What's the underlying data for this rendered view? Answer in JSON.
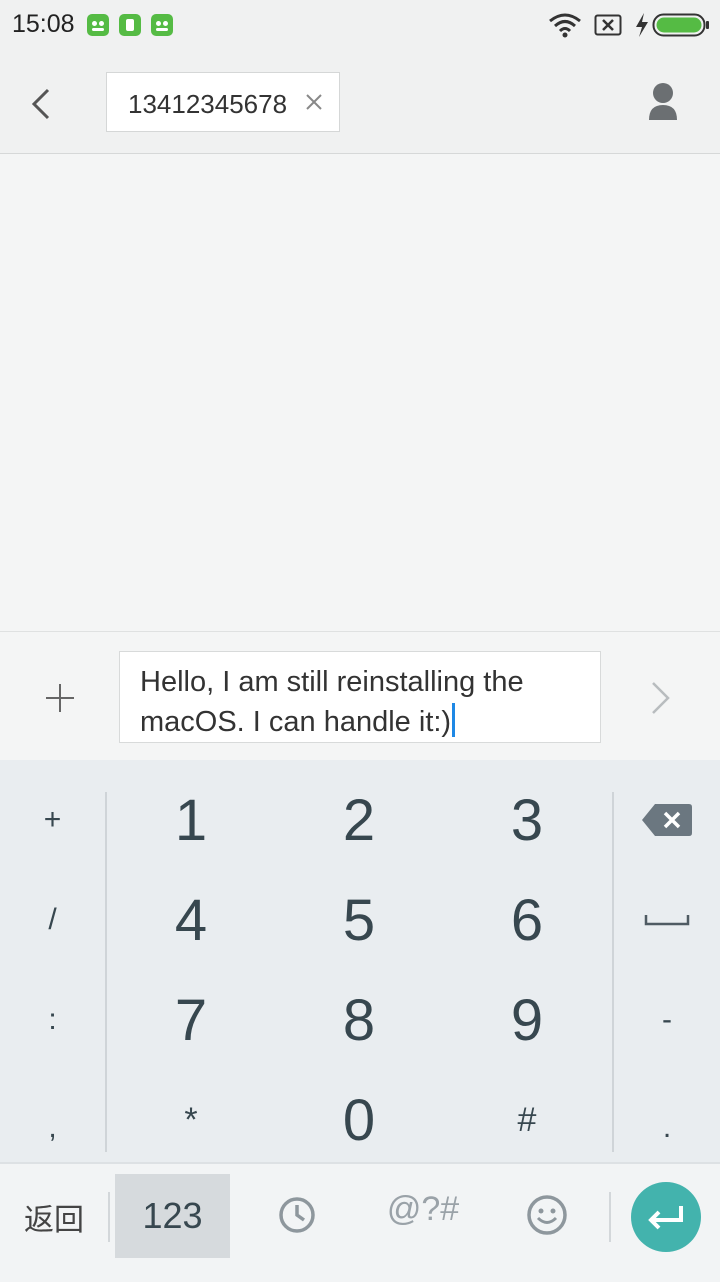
{
  "status_bar": {
    "time": "15:08",
    "icons": [
      "app-notification-icon",
      "sim-card-icon",
      "app-notification-icon",
      "wifi-icon",
      "no-sim-icon",
      "charging-icon",
      "battery-icon"
    ]
  },
  "header": {
    "recipient": "13412345678",
    "icons": [
      "back-arrow-icon",
      "clear-icon",
      "contact-icon"
    ]
  },
  "composer": {
    "message_text": "Hello, I am still reinstalling the macOS. I can handle it:)",
    "icons": [
      "plus-icon",
      "send-arrow-icon"
    ]
  },
  "keypad": {
    "left_column": [
      "+",
      "/",
      ":",
      ","
    ],
    "digits": [
      [
        "1",
        "2",
        "3"
      ],
      [
        "4",
        "5",
        "6"
      ],
      [
        "7",
        "8",
        "9"
      ],
      [
        "*",
        "0",
        "#"
      ]
    ],
    "right_column": [
      "backspace-icon",
      "space-icon",
      "-",
      "."
    ]
  },
  "toolbar": {
    "return_label": "返回",
    "numeric_label": "123",
    "symbols_label": "@?#",
    "icons": [
      "clock-icon",
      "emoji-icon",
      "enter-icon"
    ]
  },
  "colors": {
    "accent": "#43b3ad",
    "caret": "#1e88e5",
    "battery": "#55bb44",
    "key_text": "#37474f"
  }
}
